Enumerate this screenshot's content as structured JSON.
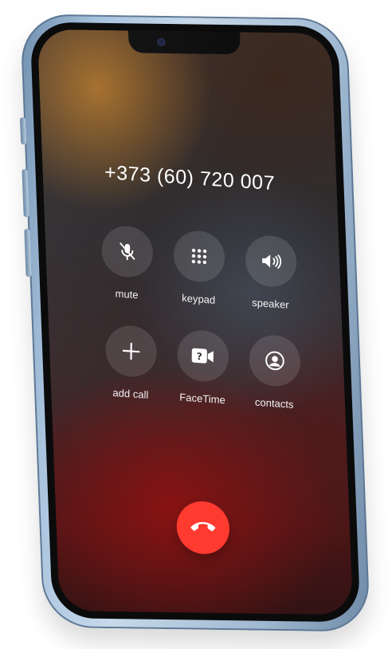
{
  "call": {
    "number": "+373 (60) 720 007"
  },
  "controls": {
    "row1": [
      {
        "label": "mute",
        "icon": "mic-off-icon"
      },
      {
        "label": "keypad",
        "icon": "keypad-icon"
      },
      {
        "label": "speaker",
        "icon": "speaker-icon"
      }
    ],
    "row2": [
      {
        "label": "add call",
        "icon": "plus-icon"
      },
      {
        "label": "FaceTime",
        "icon": "facetime-icon"
      },
      {
        "label": "contacts",
        "icon": "contacts-icon"
      }
    ]
  },
  "end_call": {
    "icon": "phone-hangup-icon",
    "color": "#ff3b30"
  },
  "device": {
    "frame_color": "#a9c3dd"
  }
}
